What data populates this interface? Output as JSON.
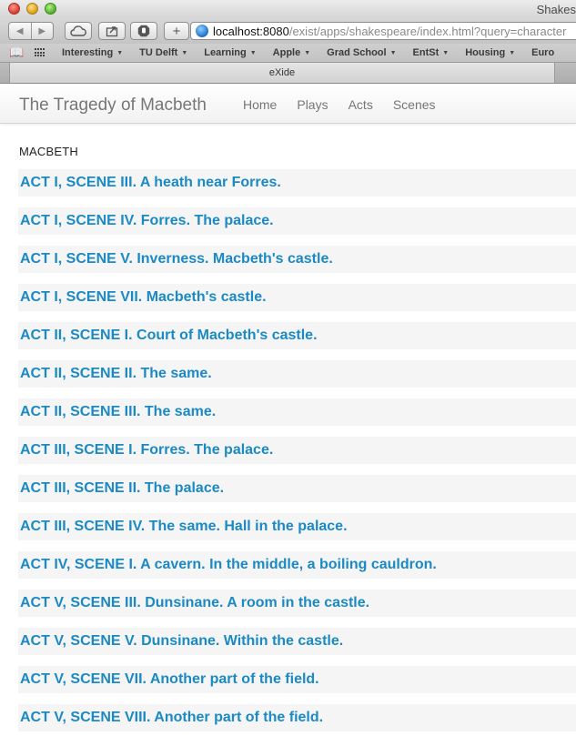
{
  "window": {
    "title": "Shakes"
  },
  "toolbar": {
    "url_host": "localhost:8080",
    "url_path": "/exist/apps/shakespeare/index.html?query=character",
    "add_label": "+"
  },
  "bookmarks": {
    "items": [
      {
        "label": "Interesting"
      },
      {
        "label": "TU Delft"
      },
      {
        "label": "Learning"
      },
      {
        "label": "Apple"
      },
      {
        "label": "Grad School"
      },
      {
        "label": "EntSt"
      },
      {
        "label": "Housing"
      },
      {
        "label": "Euro"
      }
    ]
  },
  "tab": {
    "label": "eXide"
  },
  "navbar": {
    "brand": "The Tragedy of Macbeth",
    "links": [
      {
        "label": "Home"
      },
      {
        "label": "Plays"
      },
      {
        "label": "Acts"
      },
      {
        "label": "Scenes"
      }
    ]
  },
  "content": {
    "character": "MACBETH",
    "scenes": [
      {
        "label": "ACT I, SCENE III. A heath near Forres."
      },
      {
        "label": "ACT I, SCENE IV. Forres. The palace."
      },
      {
        "label": "ACT I, SCENE V. Inverness. Macbeth's castle."
      },
      {
        "label": "ACT I, SCENE VII. Macbeth's castle."
      },
      {
        "label": "ACT II, SCENE I. Court of Macbeth's castle."
      },
      {
        "label": "ACT II, SCENE II. The same."
      },
      {
        "label": "ACT II, SCENE III. The same."
      },
      {
        "label": "ACT III, SCENE I. Forres. The palace."
      },
      {
        "label": "ACT III, SCENE II. The palace."
      },
      {
        "label": "ACT III, SCENE IV. The same. Hall in the palace."
      },
      {
        "label": "ACT IV, SCENE I. A cavern. In the middle, a boiling cauldron."
      },
      {
        "label": "ACT V, SCENE III. Dunsinane. A room in the castle."
      },
      {
        "label": "ACT V, SCENE V. Dunsinane. Within the castle."
      },
      {
        "label": "ACT V, SCENE VII. Another part of the field."
      },
      {
        "label": "ACT V, SCENE VIII. Another part of the field."
      }
    ]
  },
  "colors": {
    "link": "#1b8ac4",
    "brand_text": "#777777",
    "row_background": "#f5f5f5"
  }
}
